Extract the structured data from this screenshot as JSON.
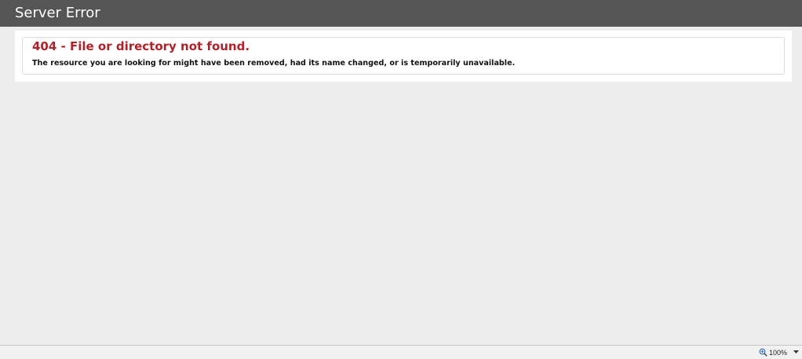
{
  "header": {
    "title": "Server Error"
  },
  "error": {
    "heading": "404 - File or directory not found.",
    "message": "The resource you are looking for might have been removed, had its name changed, or is temporarily unavailable."
  },
  "status_bar": {
    "zoom_level": "100%",
    "zoom_icon": "zoom-in-icon",
    "dropdown_icon": "chevron-down-icon"
  },
  "colors": {
    "header_bg": "#555555",
    "error_heading": "#b0212a",
    "page_bg": "#ededed"
  }
}
